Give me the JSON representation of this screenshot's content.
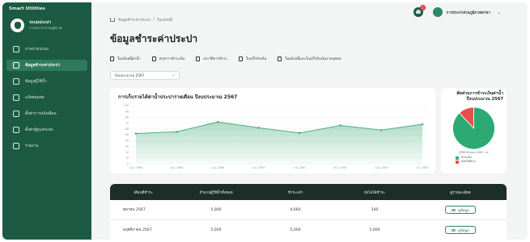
{
  "app": {
    "title": "Smart Utilities"
  },
  "profile": {
    "name": "ระบบประปา",
    "subtitle": "การประปาส่วนภูมิภาค"
  },
  "sidebar": {
    "items": [
      {
        "label": "ภาพรวมระบบ",
        "icon": "dashboard-icon",
        "active": false
      },
      {
        "label": "ข้อมูลชำระค่าประปา",
        "icon": "water-icon",
        "active": true
      },
      {
        "label": "ข้อมูลผู้ใช้น้ำ",
        "icon": "user-icon",
        "active": false
      },
      {
        "label": "แจ้งซ่อมท่อ",
        "icon": "wrench-icon",
        "active": false
      },
      {
        "label": "ตั้งค่าการแจ้งเตือน",
        "icon": "bell-icon",
        "active": false
      },
      {
        "label": "ตั้งค่าผู้ดูแลระบบ",
        "icon": "settings-icon",
        "active": false
      },
      {
        "label": "รายงาน",
        "icon": "report-icon",
        "active": false
      }
    ]
  },
  "header": {
    "notification_count": "1",
    "user_name": "การประปาส่วนภูมิภาคสาขา",
    "breadcrumb": [
      "ข้อมูลชำระค่าประปา",
      "ใบแจ้งหนี้"
    ]
  },
  "page_title": "ข้อมูลชำระค่าประปา",
  "links": [
    {
      "label": "ใบแจ้งหนี้ค่าน้ำ"
    },
    {
      "label": "สรุปการชำระเงิน"
    },
    {
      "label": "ประวัติการชำระ"
    },
    {
      "label": "ใบเสร็จรับเงิน"
    },
    {
      "label": "ใบแจ้งหนี้และใบเสร็จรับเงินรายบุคคล"
    }
  ],
  "year_select": {
    "value": "ปีงบประมาณ 2567"
  },
  "chart_data": {
    "type": "area",
    "title": "การเก็บรายได้ค่าน้ำประปารายเดือน ปีงบประมาณ 2567",
    "categories": [
      "ต.ค. 2566",
      "พ.ย. 2566",
      "ธ.ค. 2566",
      "ม.ค. 2567",
      "ก.พ. 2567",
      "มี.ค. 2567",
      "เม.ย. 2567",
      "พ.ค. 2567",
      "มิ.ย. 2567",
      "ก.ย. 2567"
    ],
    "values": [
      52,
      55,
      72,
      62,
      53,
      66,
      58,
      68
    ],
    "x_labels": [
      "ต.ค. 2566",
      "พ.ย. 2566",
      "ธ.ค. 2566",
      "ม.ค. 2567",
      "ก.พ. 2567",
      "มี.ค. 2567",
      "เม.ย. 2567",
      "ก.ย. 2567"
    ],
    "y_ticks": [
      "100",
      "90",
      "80",
      "70",
      "60",
      "50",
      "40",
      "30",
      "20",
      "10",
      "0"
    ],
    "ylim": [
      0,
      100
    ],
    "grid": true,
    "color": "#4caf7d"
  },
  "pie": {
    "title": "สัดส่วนการชำระเงินค่าน้ำ ปีงบประมาณ 2567",
    "subtitle": "ผู้ใช้น้ำทั้งหมด 4,890 ราย",
    "chart_data": {
      "type": "pie",
      "slices": [
        {
          "name": "ชำระแล้ว",
          "value": 88,
          "color": "#2daa73"
        },
        {
          "name": "ยังไม่ได้ชำระ",
          "value": 12,
          "color": "#e8504e"
        }
      ]
    }
  },
  "table": {
    "headers": [
      "เดือนที่ชำระ",
      "จำนวนผู้ใช้น้ำทั้งหมด",
      "ชำระแล้ว",
      "ยังไม่ได้ชำระ",
      "ดูรายละเอียด"
    ],
    "rows": [
      {
        "month": "ตุลาคม 2567",
        "total": "5,000",
        "paid": "4,660",
        "unpaid": "340",
        "action": "ดูข้อมูล"
      },
      {
        "month": "พฤศจิกายน 2567",
        "total": "5,000",
        "paid": "5,000",
        "unpaid": "5,000",
        "action": "ดูข้อมูล"
      }
    ]
  }
}
